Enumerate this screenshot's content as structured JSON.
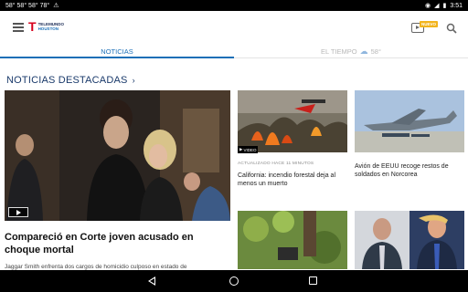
{
  "status_bar": {
    "left_text": "58° 58° 58° 78°",
    "time": "3:51"
  },
  "header": {
    "logo_mark": "T",
    "logo_brand": "TELEMUNDO",
    "logo_city": "HOUSTON",
    "nuevo_badge": "NUEVO",
    "icons": [
      "menu-icon",
      "tv-play-icon",
      "search-icon"
    ]
  },
  "tabs": [
    {
      "label": "NOTICIAS",
      "active": true
    },
    {
      "label": "EL TIEMPO",
      "temperature": "58°",
      "icon": "partly-cloudy-icon",
      "active": false
    }
  ],
  "section": {
    "title": "NOTICIAS DESTACADAS",
    "chevron": "›"
  },
  "hero": {
    "headline": "Compareció en Corte joven acusado en choque mortal",
    "subtitle": "Jaggar Smith enfrenta dos cargos de homicidio culposo en estado de"
  },
  "cards": [
    {
      "video_label": "VIDEO",
      "meta": "ACTUALIZADO HACE 11 MINUTOS",
      "title": "California: incendio forestal deja al menos un muerto"
    },
    {
      "title": "Avión de EEUU recoge restos de soldados en Norcorea"
    },
    {
      "title": ""
    },
    {
      "title": ""
    }
  ],
  "colors": {
    "brand_red": "#d7001c",
    "accent_blue": "#1b6fb7",
    "section_navy": "#1a3a6b",
    "badge_yellow": "#f2b41c"
  }
}
